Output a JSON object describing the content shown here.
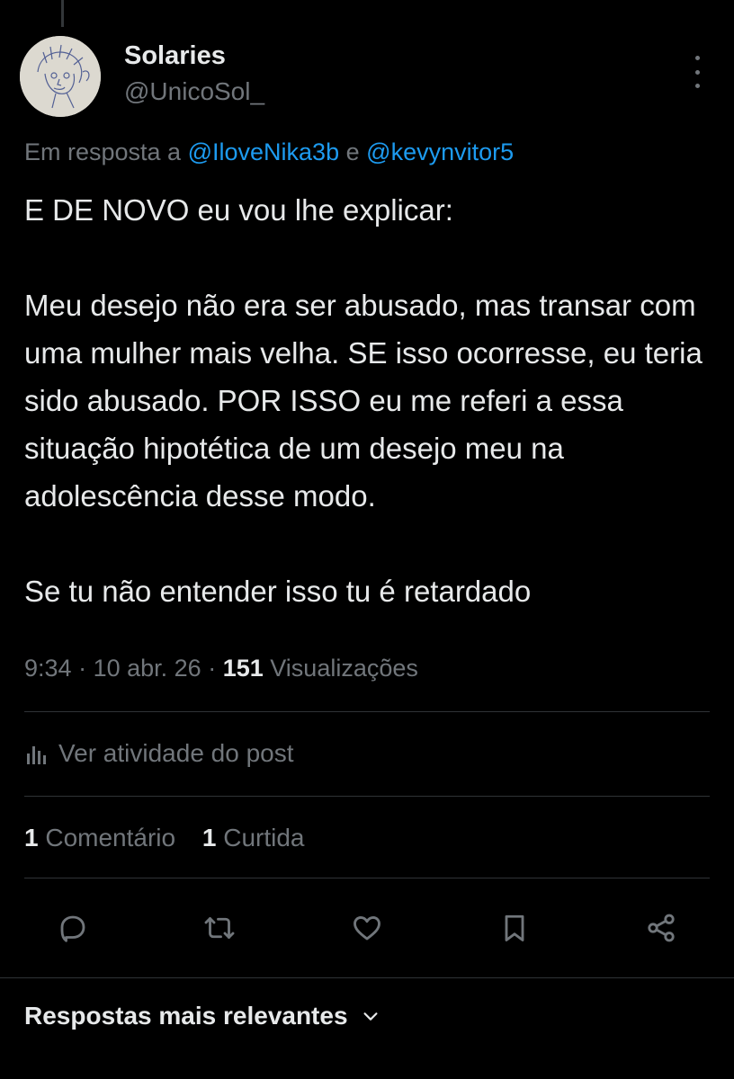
{
  "author": {
    "display_name": "Solaries",
    "handle": "@UnicoSol_",
    "avatar_icon": "sketch-portrait-avatar"
  },
  "reply_to": {
    "prefix": "Em resposta a",
    "mention1": "@IloveNika3b",
    "conjunction": "e",
    "mention2": "@kevynvitor5"
  },
  "tweet": {
    "line1": "E DE NOVO eu vou lhe explicar:",
    "paragraph2": "Meu desejo não era ser abusado, mas transar com uma mulher mais velha. SE isso ocorresse, eu teria sido abusado. POR ISSO eu me referi a essa situação hipotética de um desejo meu na adolescência desse modo.",
    "paragraph3": "Se tu não entender isso tu é retardado"
  },
  "meta": {
    "time": "9:34",
    "date": "10 abr. 26",
    "views_count": "151",
    "views_label": "Visualizações"
  },
  "activity": {
    "label": "Ver atividade do post",
    "icon": "bar-chart-icon"
  },
  "stats": {
    "comments_count": "1",
    "comments_label": "Comentário",
    "likes_count": "1",
    "likes_label": "Curtida"
  },
  "actions": [
    "reply-icon",
    "retweet-icon",
    "like-icon",
    "bookmark-icon",
    "share-icon"
  ],
  "replies_sort": {
    "label": "Respostas mais relevantes"
  },
  "colors": {
    "background": "#000000",
    "text": "#e7e9ea",
    "muted": "#71767b",
    "link": "#1d9bf0"
  }
}
